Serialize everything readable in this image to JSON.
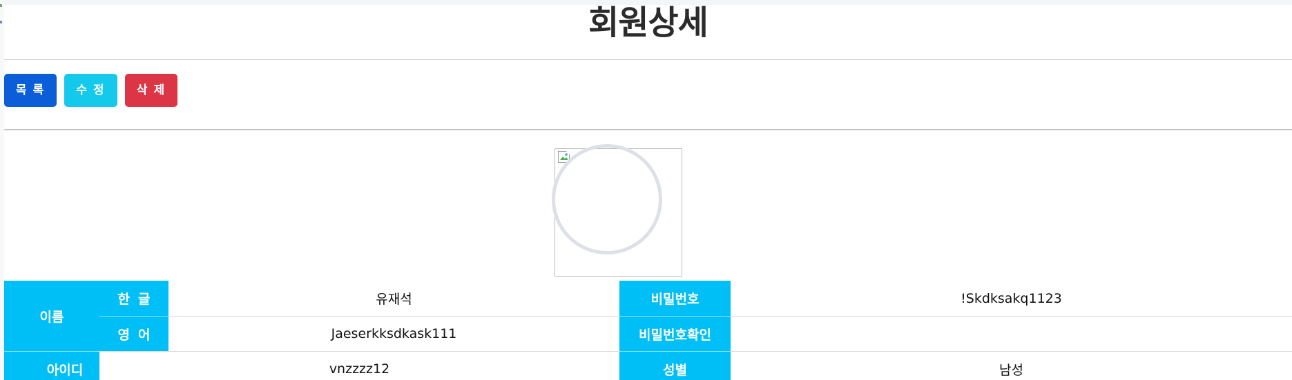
{
  "page": {
    "title": "회원상세"
  },
  "toolbar": {
    "list_label": "목록",
    "edit_label": "수정",
    "delete_label": "삭제"
  },
  "colors": {
    "list_button": "#0b5ed7",
    "edit_button": "#15c9ec",
    "delete_button": "#dc3545",
    "table_header": "#00bff6"
  },
  "profile": {
    "image_icon": "broken-image-icon"
  },
  "member": {
    "name_header": "이름",
    "korean_label": "한글",
    "korean_name": "유재석",
    "english_label": "영어",
    "english_name": "Jaeserkksdkask111",
    "password_label": "비밀번호",
    "password": "!Skdksakq1123",
    "password_confirm_label": "비밀번호확인",
    "password_confirm": "",
    "id_label": "아이디",
    "id": "vnzzzz12",
    "gender_label": "성별",
    "gender": "남성"
  }
}
